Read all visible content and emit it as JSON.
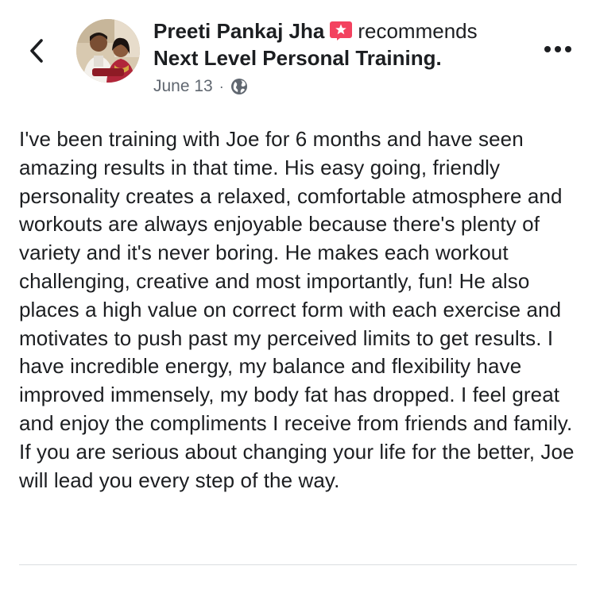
{
  "header": {
    "back_icon": "chevron-left-icon",
    "author_name": "Preeti Pankaj Jha",
    "badge_icon": "recommendation-star-icon",
    "badge_color": "#f3425f",
    "action_text": "recommends",
    "page_name": "Next Level Personal Training.",
    "date": "June 13",
    "separator": "·",
    "privacy_icon": "globe-icon",
    "more_icon": "more-horizontal-icon"
  },
  "post": {
    "text": "I've been training with Joe for 6 months and have seen amazing results in that time. His easy going, friendly personality creates a relaxed, comfortable atmosphere and workouts are always enjoyable because there's plenty of variety and it's never boring. He makes each workout challenging, creative and most importantly, fun! He also places a high value on correct form with each exercise and motivates to push past my perceived limits to get results. I have incredible energy, my balance and flexibility have improved immensely, my body fat has dropped. I feel great and enjoy the compliments I receive from friends and family. If you are serious about changing your life for the better, Joe will lead you every step of the way."
  },
  "colors": {
    "text": "#1c1e21",
    "meta": "#606770",
    "divider": "#dadde1"
  }
}
